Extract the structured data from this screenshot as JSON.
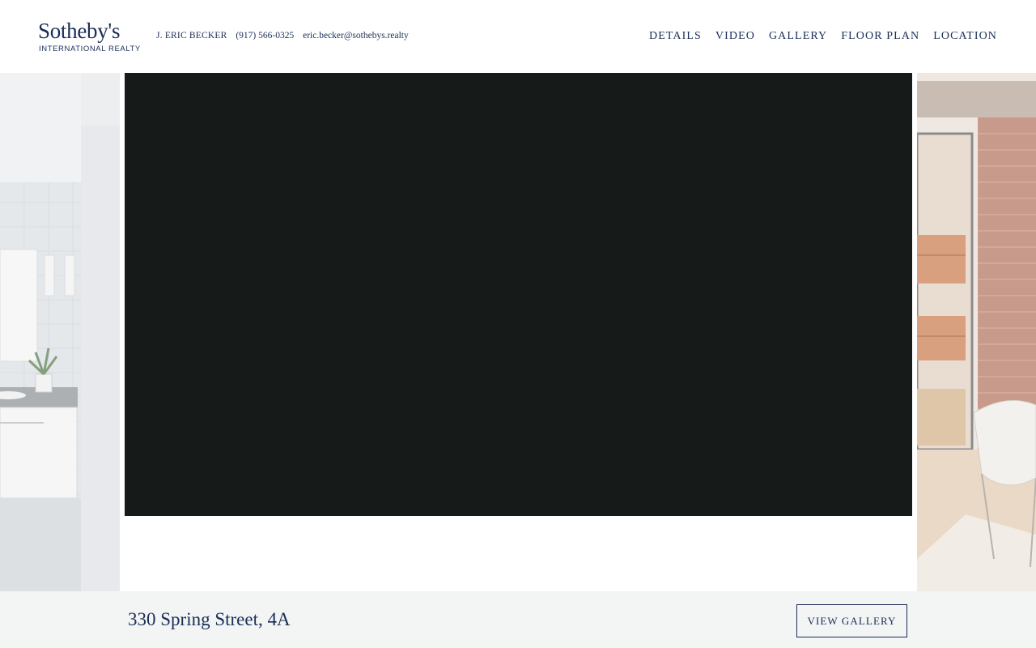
{
  "header": {
    "logo": {
      "name": "Sotheby's",
      "sub": "INTERNATIONAL REALTY"
    },
    "contact": {
      "agent": "J. ERIC BECKER",
      "phone": "(917) 566-0325",
      "email": "eric.becker@sothebys.realty"
    },
    "nav": [
      "DETAILS",
      "VIDEO",
      "GALLERY",
      "FLOOR PLAN",
      "LOCATION"
    ]
  },
  "carousel": {
    "left_image": "bathroom-photo",
    "right_image": "living-room-photo",
    "center": "video-player"
  },
  "footer": {
    "address": "330 Spring Street, 4A",
    "gallery_button": "VIEW GALLERY"
  },
  "colors": {
    "brand": "#1a2e57",
    "video_bg": "#161a18",
    "bar_bg": "#f3f4f4"
  }
}
